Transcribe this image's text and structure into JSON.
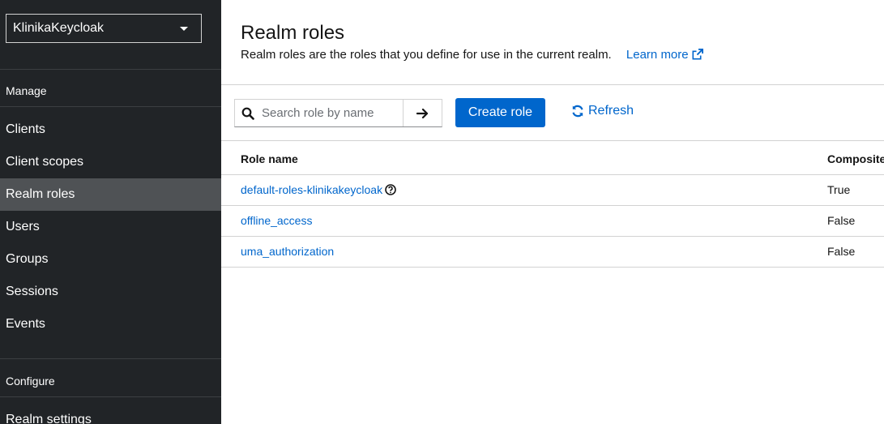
{
  "sidebar": {
    "realm_selector": "KlinikaKeycloak",
    "manage_title": "Manage",
    "manage_items": [
      {
        "label": "Clients",
        "active": false
      },
      {
        "label": "Client scopes",
        "active": false
      },
      {
        "label": "Realm roles",
        "active": true
      },
      {
        "label": "Users",
        "active": false
      },
      {
        "label": "Groups",
        "active": false
      },
      {
        "label": "Sessions",
        "active": false
      },
      {
        "label": "Events",
        "active": false
      }
    ],
    "configure_title": "Configure",
    "configure_items": [
      {
        "label": "Realm settings"
      }
    ]
  },
  "page": {
    "title": "Realm roles",
    "description": "Realm roles are the roles that you define for use in the current realm.",
    "learn_more": "Learn more"
  },
  "toolbar": {
    "search_placeholder": "Search role by name",
    "create_label": "Create role",
    "refresh_label": "Refresh"
  },
  "table": {
    "columns": [
      "Role name",
      "Composite"
    ],
    "rows": [
      {
        "name": "default-roles-klinikakeycloak",
        "composite": "True",
        "help_icon": "question-circle-icon"
      },
      {
        "name": "offline_access",
        "composite": "False"
      },
      {
        "name": "uma_authorization",
        "composite": "False"
      }
    ]
  },
  "colors": {
    "sidebar_bg": "#212427",
    "sidebar_active": "#4f5255",
    "primary": "#0066cc",
    "link": "#0066cc"
  }
}
